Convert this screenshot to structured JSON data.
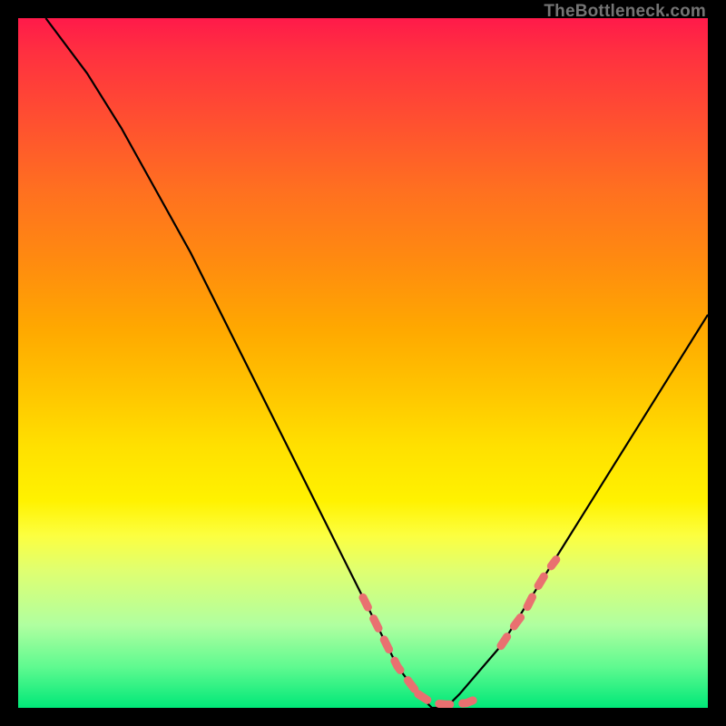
{
  "watermark": "TheBottleneck.com",
  "chart_data": {
    "type": "line",
    "title": "",
    "xlabel": "",
    "ylabel": "",
    "xlim": [
      0,
      100
    ],
    "ylim": [
      0,
      100
    ],
    "grid": false,
    "legend": false,
    "background_gradient": {
      "direction": "top-to-bottom",
      "stops": [
        {
          "pos": 0,
          "color": "#ff1a4a"
        },
        {
          "pos": 15,
          "color": "#ff5030"
        },
        {
          "pos": 35,
          "color": "#ff8a10"
        },
        {
          "pos": 55,
          "color": "#ffc800"
        },
        {
          "pos": 70,
          "color": "#fff200"
        },
        {
          "pos": 85,
          "color": "#c0ff90"
        },
        {
          "pos": 100,
          "color": "#00e878"
        }
      ]
    },
    "series": [
      {
        "name": "primary-curve",
        "style": "solid",
        "color": "#000000",
        "x": [
          4,
          10,
          15,
          20,
          25,
          30,
          35,
          40,
          45,
          50,
          55,
          58,
          60,
          62,
          64,
          70,
          75,
          80,
          85,
          90,
          95,
          100
        ],
        "y": [
          100,
          92,
          84,
          75,
          66,
          56,
          46,
          36,
          26,
          16,
          6,
          2,
          0,
          0,
          2,
          9,
          17,
          25,
          33,
          41,
          49,
          57
        ]
      },
      {
        "name": "marker-band-left",
        "style": "dashed-thick",
        "color": "#e97070",
        "x": [
          50,
          52,
          53.5,
          55,
          56.5,
          58
        ],
        "y": [
          16,
          12,
          9,
          6,
          4,
          2
        ]
      },
      {
        "name": "marker-band-bottom",
        "style": "dashed-thick",
        "color": "#e97070",
        "x": [
          58,
          60,
          62,
          63,
          65,
          67
        ],
        "y": [
          2,
          0.7,
          0.5,
          0.5,
          0.7,
          1.5
        ]
      },
      {
        "name": "marker-band-right",
        "style": "dashed-thick",
        "color": "#e97070",
        "x": [
          70,
          72,
          73.5,
          75,
          76.5,
          78
        ],
        "y": [
          9,
          12,
          14,
          17,
          19.5,
          21.5
        ]
      }
    ]
  }
}
